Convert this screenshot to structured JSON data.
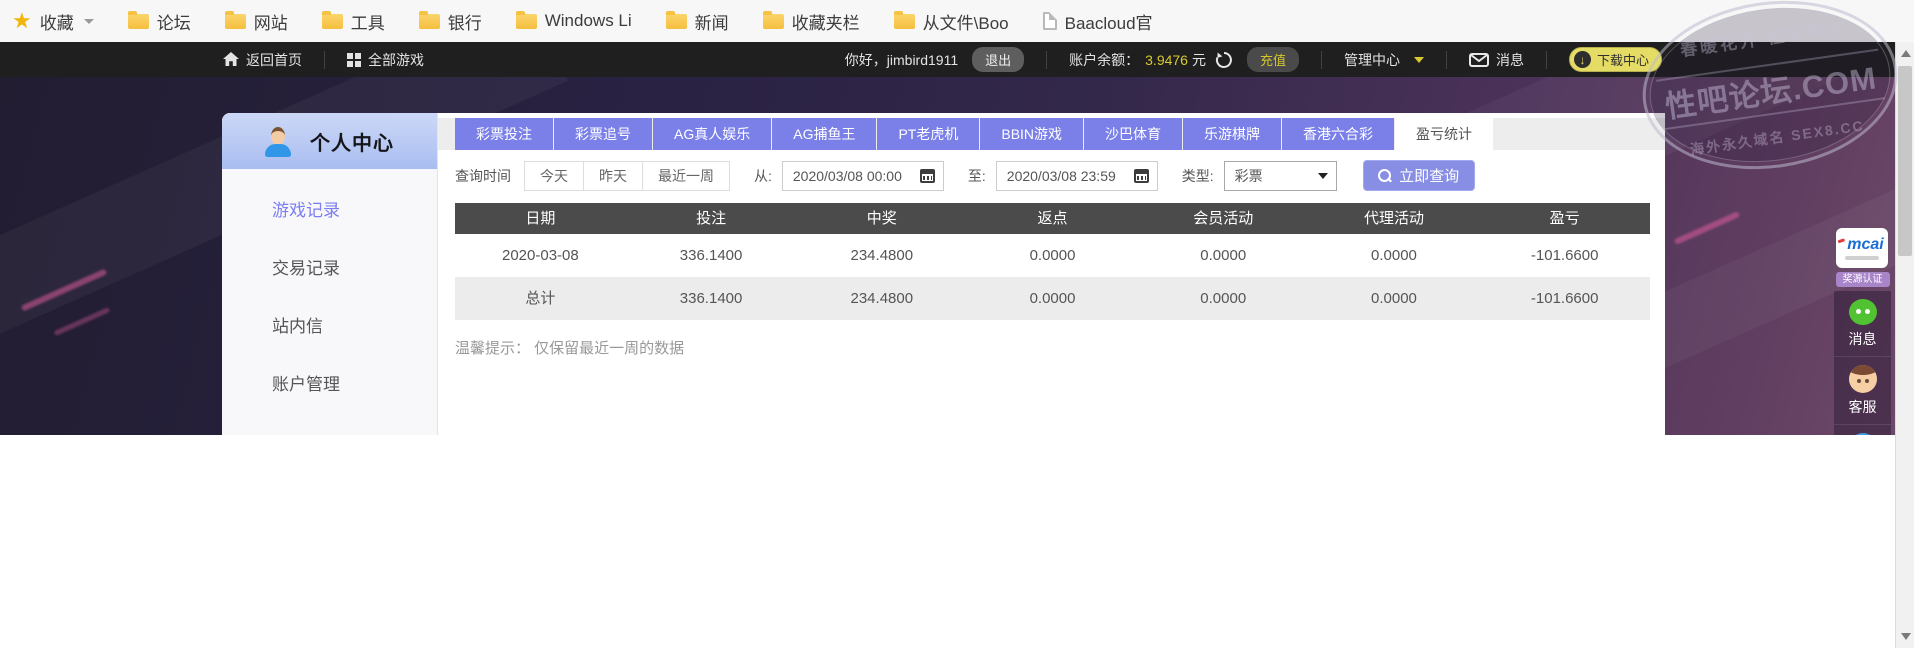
{
  "bookmarks_bar": {
    "favorites_label": "收藏",
    "folders": [
      "论坛",
      "网站",
      "工具",
      "银行",
      "Windows Li",
      "新闻",
      "收藏夹栏",
      "从文件\\Boo"
    ],
    "page_item": "Baacloud官"
  },
  "navbar": {
    "home_label": "返回首页",
    "all_games_label": "全部游戏",
    "greeting": "你好，jimbird1911",
    "logout_label": "退出",
    "balance_label": "账户余额：",
    "balance_value": "3.9476",
    "balance_unit": "元",
    "recharge_label": "充值",
    "admin_label": "管理中心",
    "messages_label": "消息",
    "download_label": "下载中心"
  },
  "sidebar": {
    "title": "个人中心",
    "items": [
      {
        "label": "游戏记录",
        "active": true
      },
      {
        "label": "交易记录",
        "active": false
      },
      {
        "label": "站内信",
        "active": false
      },
      {
        "label": "账户管理",
        "active": false
      }
    ]
  },
  "tabs": [
    "彩票投注",
    "彩票追号",
    "AG真人娱乐",
    "AG捕鱼王",
    "PT老虎机",
    "BBIN游戏",
    "沙巴体育",
    "乐游棋牌",
    "香港六合彩",
    "盈亏统计"
  ],
  "active_tab": "盈亏统计",
  "filters": {
    "time_label": "查询时间",
    "quick_today": "今天",
    "quick_yesterday": "昨天",
    "quick_week": "最近一周",
    "from_label": "从:",
    "from_value": "2020/03/08 00:00",
    "to_label": "至:",
    "to_value": "2020/03/08 23:59",
    "type_label": "类型:",
    "type_value": "彩票",
    "search_label": "立即查询"
  },
  "table": {
    "headers": [
      "日期",
      "投注",
      "中奖",
      "返点",
      "会员活动",
      "代理活动",
      "盈亏"
    ],
    "rows": [
      [
        "2020-03-08",
        "336.1400",
        "234.4800",
        "0.0000",
        "0.0000",
        "0.0000",
        "-101.6600"
      ],
      [
        "总计",
        "336.1400",
        "234.4800",
        "0.0000",
        "0.0000",
        "0.0000",
        "-101.6600"
      ]
    ]
  },
  "note": "温馨提示： 仅保留最近一周的数据",
  "watermark": {
    "arc_top": "春暖花开 性吧有你",
    "center": "性吧论坛.COM",
    "arc_bottom": "海外永久域名 SEX8.CC"
  },
  "floating": {
    "logo_text": "mcai",
    "cert_label": "奖源认证",
    "chat_label": "消息",
    "service_label": "客服"
  },
  "colors": {
    "tab_accent": "#7a80e8",
    "balance_yellow": "#d9ca2f",
    "download_yellow": "#e5dc66",
    "table_header_bg": "#4b4b4b",
    "sidebar_active": "#7a7ef0"
  }
}
